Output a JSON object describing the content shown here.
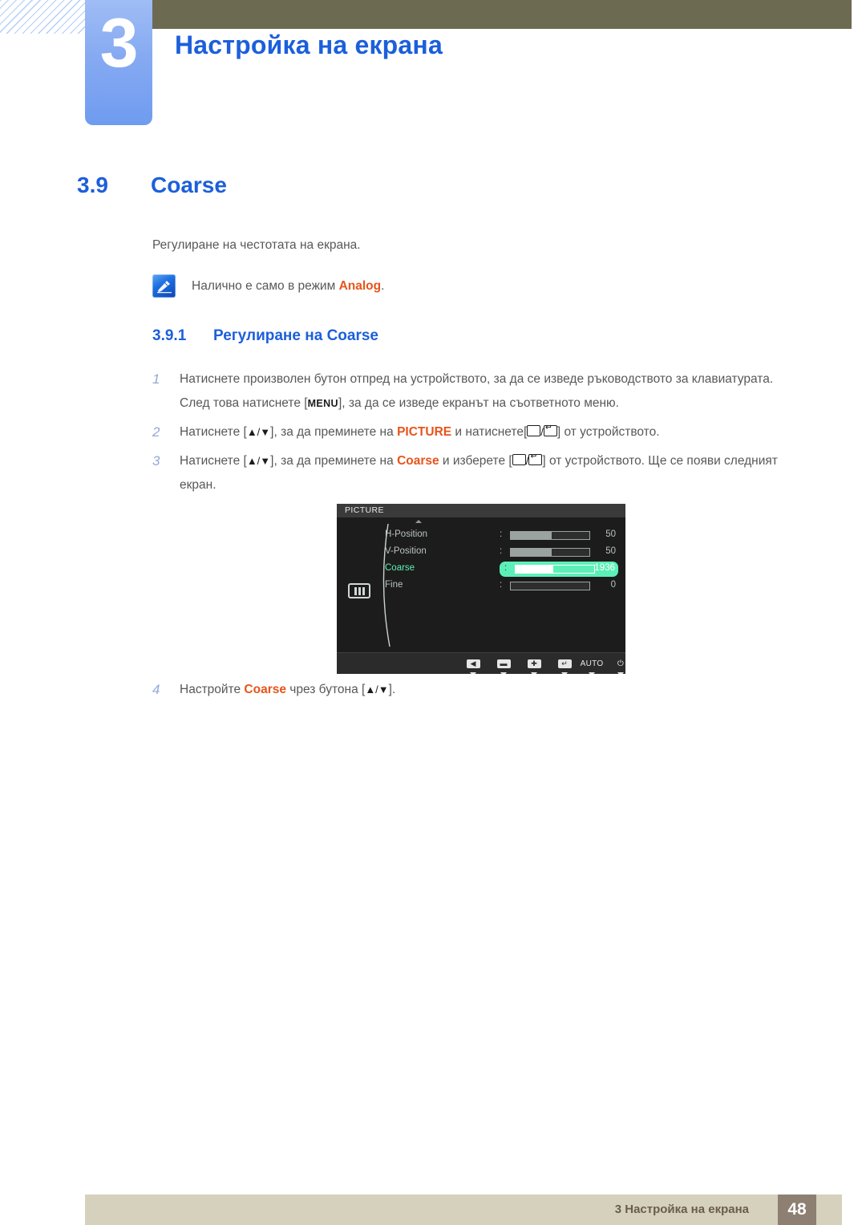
{
  "header": {
    "chapter_number": "3",
    "chapter_title": "Настройка на екрана"
  },
  "section": {
    "number": "3.9",
    "title": "Coarse"
  },
  "intro": "Регулиране на честотата на екрана.",
  "note": {
    "icon": "note-pen-icon",
    "text_before": "Налично е само в режим ",
    "highlight": "Analog",
    "text_after": "."
  },
  "subsection": {
    "number": "3.9.1",
    "title": "Регулиране на Coarse"
  },
  "steps": [
    {
      "num": "1",
      "part1": "Натиснете произволен бутон отпред на устройството, за да се изведе ръководството за клавиатурата. След това натиснете [",
      "kbd": "MENU",
      "part2": "], за да се изведе екранът на съответното меню."
    },
    {
      "num": "2",
      "part1": "Натиснете [",
      "arrows": "▲/▼",
      "part2": "], за да преминете на ",
      "highlight": "PICTURE",
      "part3": " и натиснете[",
      "part4": "] от устройството."
    },
    {
      "num": "3",
      "part1": "Натиснете [",
      "arrows": "▲/▼",
      "part2": "], за да преминете на ",
      "highlight": "Coarse",
      "part3": " и изберете [",
      "part4": "] от устройството. Ще се появи следният екран."
    },
    {
      "num": "4",
      "part1": "Настройте ",
      "highlight": "Coarse",
      "part2": " чрез бутона [",
      "arrows": "▲/▼",
      "part3": "]."
    }
  ],
  "osd": {
    "title": "PICTURE",
    "category_icon": "picture-bars-icon",
    "scroll_up_caret": "caret-up-icon",
    "rows": [
      {
        "label": "H-Position",
        "value": "50",
        "fill_pct": 52,
        "selected": false
      },
      {
        "label": "V-Position",
        "value": "50",
        "fill_pct": 52,
        "selected": false
      },
      {
        "label": "Coarse",
        "value": "1936",
        "fill_pct": 48,
        "selected": true
      },
      {
        "label": "Fine",
        "value": "0",
        "fill_pct": 0,
        "selected": false
      }
    ],
    "buttons": [
      {
        "icon": "back-arrow-icon",
        "glyph": "◀",
        "type": "icon"
      },
      {
        "icon": "minus-icon",
        "glyph": "▬",
        "type": "icon"
      },
      {
        "icon": "plus-icon",
        "glyph": "✚",
        "type": "icon"
      },
      {
        "icon": "enter-icon",
        "glyph": "↵",
        "type": "icon"
      },
      {
        "icon": "auto-label",
        "glyph": "AUTO",
        "type": "text"
      },
      {
        "icon": "power-icon",
        "glyph": "⏻",
        "type": "text"
      }
    ]
  },
  "footer": {
    "text": "3 Настройка на екрана",
    "page": "48"
  },
  "colors": {
    "blue_accent": "#1c5fdb",
    "orange_accent": "#e8541a",
    "olive_bar": "#6d6a52",
    "footer_bar": "#d6d1bd",
    "footer_page_box": "#8d7f72",
    "osd_highlight": "#5cf0b8"
  }
}
